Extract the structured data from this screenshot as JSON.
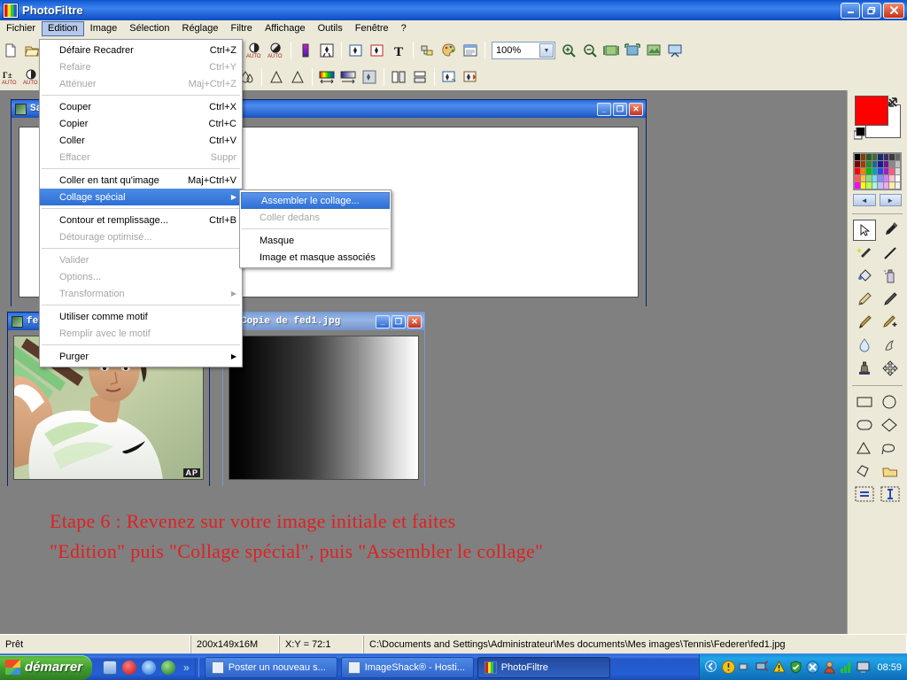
{
  "window": {
    "title": "PhotoFiltre",
    "app_icon": "photofiltre-icon",
    "buttons": {
      "minimize": "_",
      "maximize": "❐",
      "close": "✕"
    }
  },
  "menubar": {
    "items": [
      {
        "label": "Fichier",
        "active": false
      },
      {
        "label": "Edition",
        "active": true
      },
      {
        "label": "Image",
        "active": false
      },
      {
        "label": "Sélection",
        "active": false
      },
      {
        "label": "Réglage",
        "active": false
      },
      {
        "label": "Filtre",
        "active": false
      },
      {
        "label": "Affichage",
        "active": false
      },
      {
        "label": "Outils",
        "active": false
      },
      {
        "label": "Fenêtre",
        "active": false
      },
      {
        "label": "?",
        "active": false
      }
    ]
  },
  "toolbar": {
    "zoom_value": "100%",
    "zoom_dropdown_icon": "chevron-down-icon"
  },
  "edition_menu": {
    "items": [
      {
        "label": "Défaire Recadrer",
        "accel": "Ctrl+Z",
        "disabled": false,
        "submenu": false,
        "selected": false
      },
      {
        "label": "Refaire",
        "accel": "Ctrl+Y",
        "disabled": true,
        "submenu": false,
        "selected": false
      },
      {
        "label": "Atténuer",
        "accel": "Maj+Ctrl+Z",
        "disabled": true,
        "submenu": false,
        "selected": false
      },
      {
        "separator": true
      },
      {
        "label": "Couper",
        "accel": "Ctrl+X",
        "disabled": false,
        "submenu": false,
        "selected": false
      },
      {
        "label": "Copier",
        "accel": "Ctrl+C",
        "disabled": false,
        "submenu": false,
        "selected": false
      },
      {
        "label": "Coller",
        "accel": "Ctrl+V",
        "disabled": false,
        "submenu": false,
        "selected": false
      },
      {
        "label": "Effacer",
        "accel": "Suppr",
        "disabled": true,
        "submenu": false,
        "selected": false
      },
      {
        "separator": true
      },
      {
        "label": "Coller en tant qu'image",
        "accel": "Maj+Ctrl+V",
        "disabled": false,
        "submenu": false,
        "selected": false
      },
      {
        "label": "Collage spécial",
        "accel": "",
        "disabled": false,
        "submenu": true,
        "selected": true
      },
      {
        "separator": true
      },
      {
        "label": "Contour et remplissage...",
        "accel": "Ctrl+B",
        "disabled": false,
        "submenu": false,
        "selected": false
      },
      {
        "label": "Détourage optimisé...",
        "accel": "",
        "disabled": true,
        "submenu": false,
        "selected": false
      },
      {
        "separator": true
      },
      {
        "label": "Valider",
        "accel": "",
        "disabled": true,
        "submenu": false,
        "selected": false
      },
      {
        "label": "Options...",
        "accel": "",
        "disabled": true,
        "submenu": false,
        "selected": false
      },
      {
        "label": "Transformation",
        "accel": "",
        "disabled": true,
        "submenu": true,
        "selected": false
      },
      {
        "separator": true
      },
      {
        "label": "Utiliser comme motif",
        "accel": "",
        "disabled": false,
        "submenu": false,
        "selected": false
      },
      {
        "label": "Remplir avec le motif",
        "accel": "",
        "disabled": true,
        "submenu": false,
        "selected": false
      },
      {
        "separator": true
      },
      {
        "label": "Purger",
        "accel": "",
        "disabled": false,
        "submenu": true,
        "selected": false
      }
    ]
  },
  "collage_submenu": {
    "items": [
      {
        "label": "Assembler le collage...",
        "disabled": false,
        "selected": true
      },
      {
        "label": "Coller dedans",
        "disabled": true,
        "selected": false
      },
      {
        "separator": true
      },
      {
        "label": "Masque",
        "disabled": false,
        "selected": false
      },
      {
        "label": "Image et masque associés",
        "disabled": false,
        "selected": false
      }
    ]
  },
  "mdi_windows": [
    {
      "title": "Sa",
      "full_title_hidden": true,
      "active": true
    },
    {
      "title": "fe",
      "full_title_hidden": true,
      "active": true
    },
    {
      "title": "Copie de fed1.jpg",
      "full_title_hidden": false,
      "active": false
    }
  ],
  "annotation": {
    "line1": "Etape 6 : Revenez sur votre image initiale et faites",
    "line2": "\"Edition\" puis \"Collage spécial\", puis \"Assembler le collage\"",
    "color": "#e02020"
  },
  "statusbar": {
    "state": "Prêt",
    "dimensions": "200x149x16M",
    "ratio": "X:Y = 72:1",
    "path": "C:\\Documents and Settings\\Administrateur\\Mes documents\\Mes images\\Tennis\\Federer\\fed1.jpg"
  },
  "taskbar": {
    "start_label": "démarrer",
    "quick_launch": [
      "show-desktop-icon",
      "media-player-icon",
      "internet-explorer-icon",
      "msn-icon"
    ],
    "overflow_icon": "»",
    "tasks": [
      {
        "label": "Poster un nouveau s...",
        "icon": "browser-page-icon",
        "active": false
      },
      {
        "label": "ImageShack® - Hosti...",
        "icon": "browser-page-icon",
        "active": false
      },
      {
        "label": "PhotoFiltre",
        "icon": "photofiltre-icon",
        "active": true
      }
    ],
    "tray_icons": [
      "chevron-left-icon",
      "warning-bulb-icon",
      "network-icon",
      "monitor-icon",
      "alert-icon",
      "shield-icon",
      "block-icon",
      "user-icon",
      "signal-icon",
      "display-icon"
    ],
    "clock": "08:59"
  },
  "palette": {
    "foreground_color": "#ff0000",
    "background_color": "#ffffff",
    "swap_icon": "swap-colors-icon",
    "prev_label": "◄",
    "next_label": "►",
    "swatches_rows": [
      [
        "#000000",
        "#7f0000",
        "#007f00",
        "#7f7f00",
        "#00007f",
        "#7f007f",
        "#007f7f",
        "#7f7f7f"
      ],
      [
        "#804000",
        "#ff0000",
        "#00ff00",
        "#ffff00",
        "#0000ff",
        "#ff00ff",
        "#00ffff",
        "#c0c0c0"
      ],
      [
        "#ff8040",
        "#ff8080",
        "#80ff80",
        "#ffff80",
        "#8080ff",
        "#ff80ff",
        "#80ffff",
        "#e0e0e0"
      ],
      [
        "#ffc0a0",
        "#ffc0c0",
        "#c0ffc0",
        "#ffffc0",
        "#c0c0ff",
        "#ffc0ff",
        "#c0ffff",
        "#ffffff"
      ]
    ],
    "tools": [
      "arrow-select-icon",
      "eyedropper-icon",
      "magic-wand-icon",
      "line-icon",
      "paint-bucket-icon",
      "spray-can-icon",
      "pencil-icon",
      "brush-icon",
      "paintbrush-icon",
      "brush-plus-icon",
      "water-drop-icon",
      "smudge-icon",
      "clone-stamp-icon",
      "move-icon",
      "rectangle-icon",
      "ellipse-icon",
      "rounded-rect-icon",
      "diamond-icon",
      "triangle-icon",
      "lasso-icon",
      "polygon-icon",
      "open-shape-icon",
      "resize-selection-icon",
      "text-cursor-icon"
    ]
  }
}
